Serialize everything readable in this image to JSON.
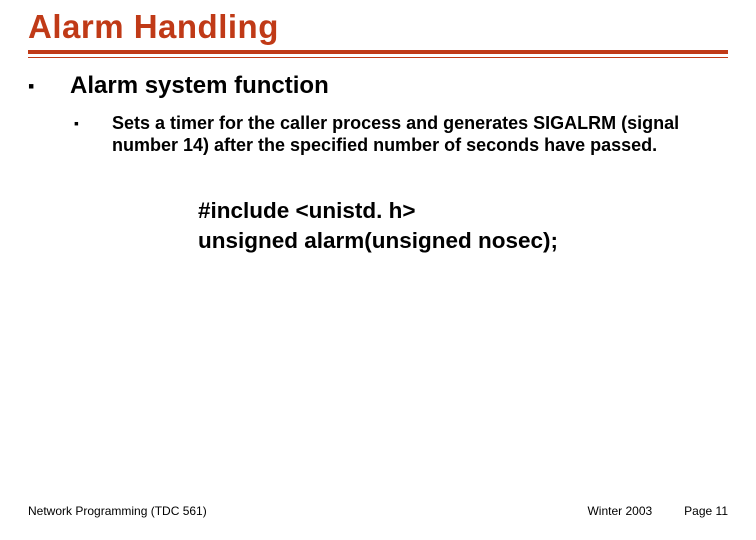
{
  "title": "Alarm  Handling",
  "lvl1_text": "Alarm system function",
  "lvl2_text": "Sets a timer for the caller process and generates SIGALRM (signal number 14) after the specified number of seconds have passed.",
  "code_line1": "#include <unistd. h>",
  "code_line2": "unsigned alarm(unsigned nosec);",
  "footer_left": "Network Programming (TDC 561)",
  "footer_term": "Winter 2003",
  "footer_page": "Page 11"
}
